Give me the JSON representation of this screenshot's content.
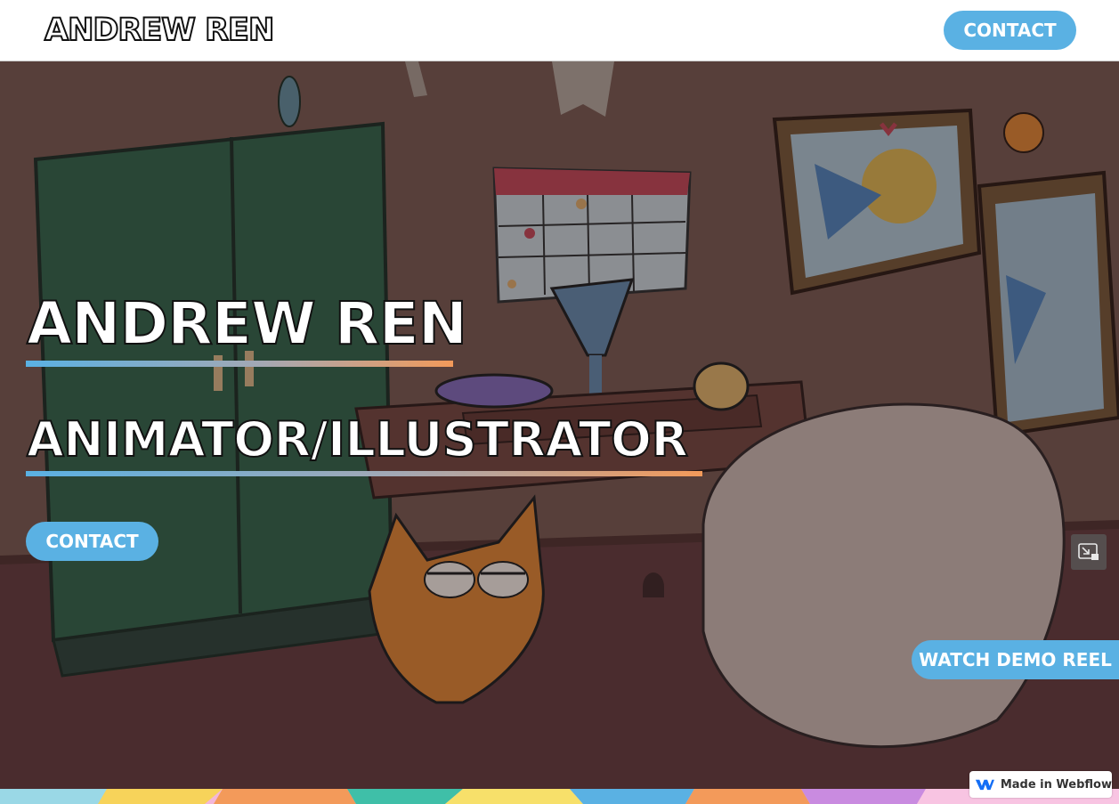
{
  "nav": {
    "brand": "ANDREW REN",
    "contact_label": "CONTACT"
  },
  "hero": {
    "title": "ANDREW REN",
    "subtitle": "ANIMATOR/ILLUSTRATOR",
    "contact_label": "CONTACT",
    "demo_reel_label": "WATCH DEMO REEL",
    "pip_icon": "picture-in-picture-icon"
  },
  "badge": {
    "label": "Made in Webflow",
    "icon": "webflow-logo-icon"
  },
  "colors": {
    "accent": "#5ab1e3",
    "gradient_end": "#f39a5a",
    "nav_background": "#ffffff"
  }
}
